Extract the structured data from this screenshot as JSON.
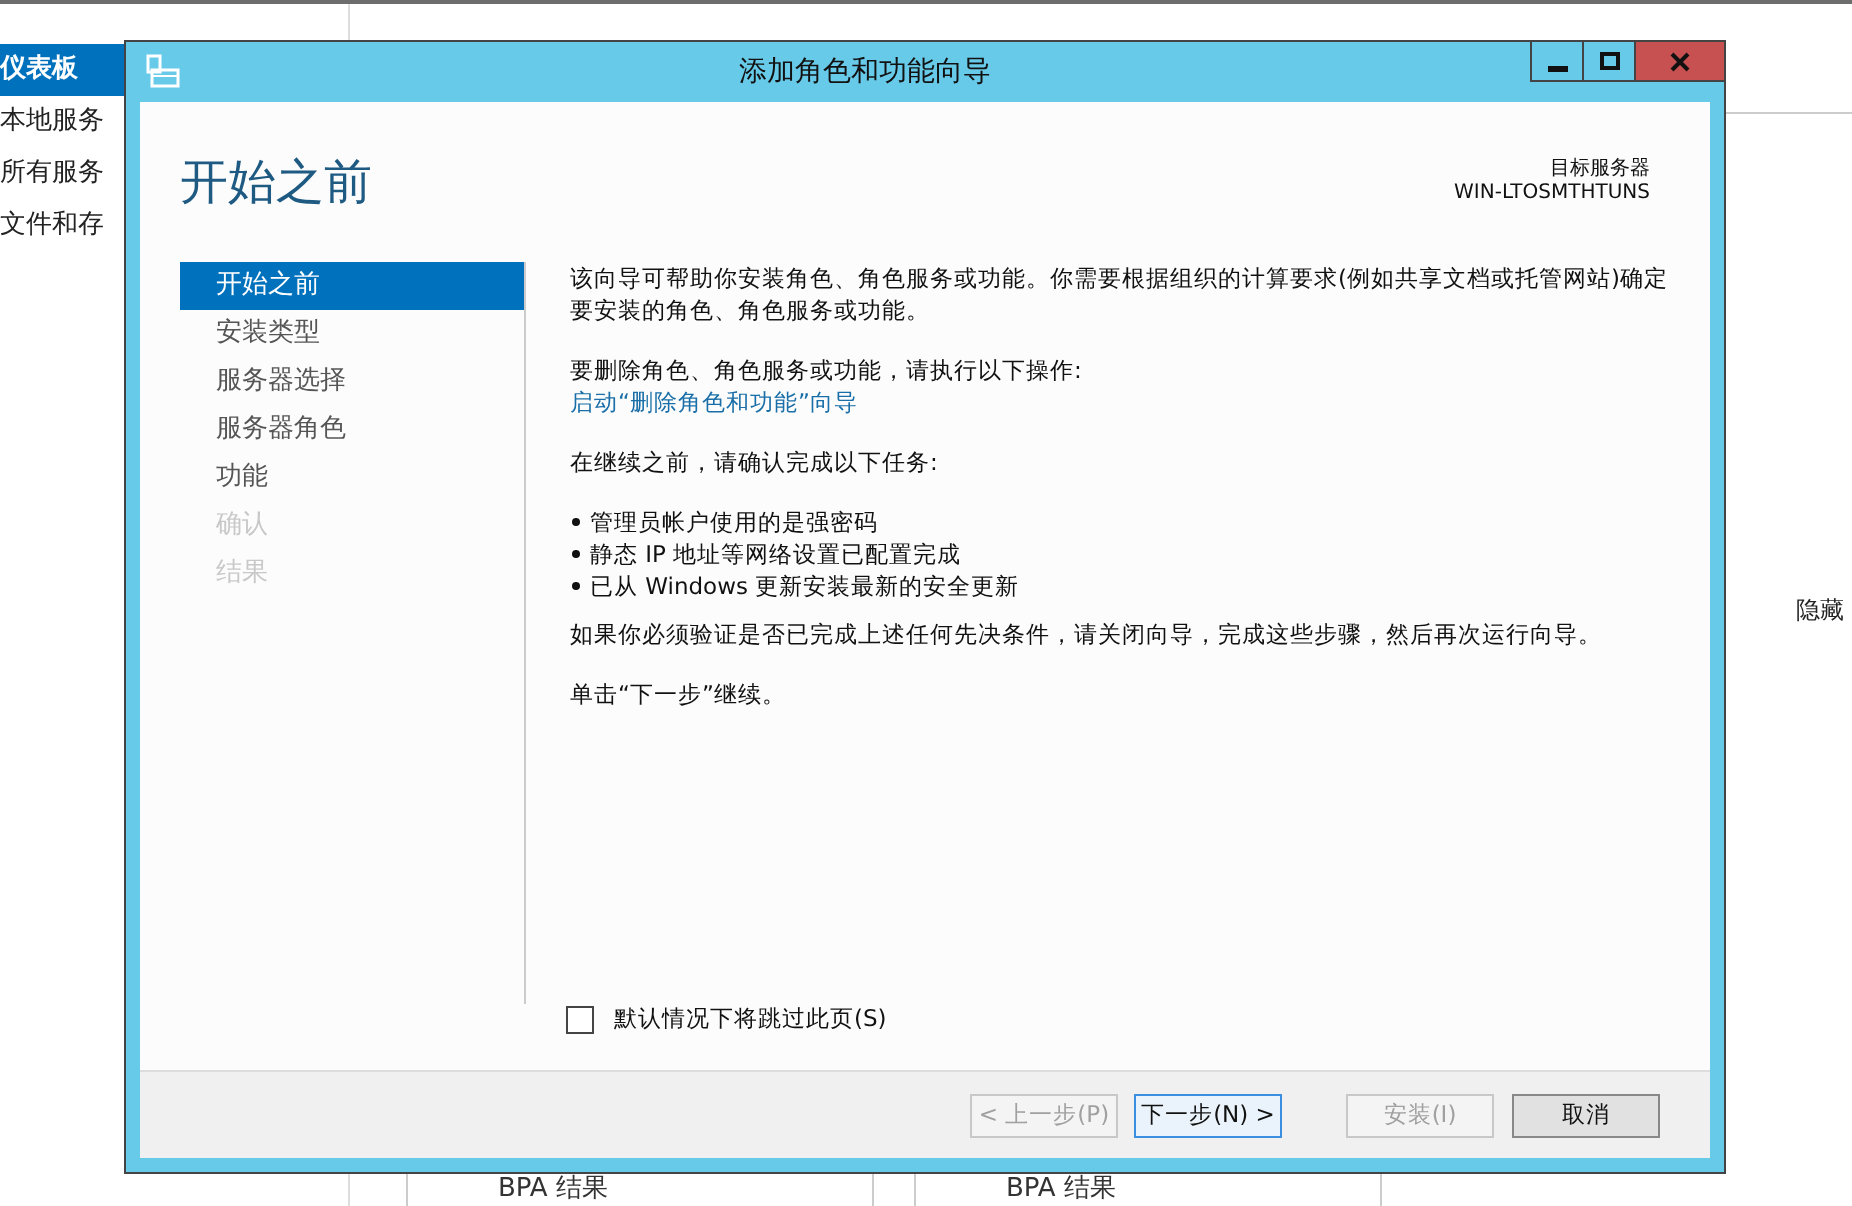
{
  "background": {
    "nav_items": [
      {
        "label": "仪表板",
        "selected": true
      },
      {
        "label": "本地服务",
        "selected": false
      },
      {
        "label": "所有服务",
        "selected": false
      },
      {
        "label": "文件和存",
        "selected": false
      }
    ],
    "hide_label": "隐藏",
    "tiles": [
      {
        "label": "BPA 结果"
      },
      {
        "label": "BPA 结果"
      }
    ]
  },
  "window": {
    "title": "添加角色和功能向导",
    "heading": "开始之前",
    "target_label": "目标服务器",
    "target_server": "WIN-LTOSMTHTUNS",
    "steps": [
      {
        "label": "开始之前",
        "selected": true,
        "disabled": false
      },
      {
        "label": "安装类型",
        "selected": false,
        "disabled": false
      },
      {
        "label": "服务器选择",
        "selected": false,
        "disabled": false
      },
      {
        "label": "服务器角色",
        "selected": false,
        "disabled": false
      },
      {
        "label": "功能",
        "selected": false,
        "disabled": false
      },
      {
        "label": "确认",
        "selected": false,
        "disabled": true
      },
      {
        "label": "结果",
        "selected": false,
        "disabled": true
      }
    ],
    "intro": "该向导可帮助你安装角色、角色服务或功能。你需要根据组织的计算要求(例如共享文档或托管网站)确定要安装的角色、角色服务或功能。",
    "remove_text": "要删除角色、角色服务或功能，请执行以下操作:",
    "remove_link": "启动“删除角色和功能”向导",
    "tasks_heading": "在继续之前，请确认完成以下任务:",
    "tasks": [
      "管理员帐户使用的是强密码",
      "静态 IP 地址等网络设置已配置完成",
      "已从 Windows 更新安装最新的安全更新"
    ],
    "verify_text": "如果你必须验证是否已完成上述任何先决条件，请关闭向导，完成这些步骤，然后再次运行向导。",
    "continue_text": "单击“下一步”继续。",
    "skip_checkbox": {
      "label": "默认情况下将跳过此页(S)",
      "checked": false
    },
    "buttons": [
      {
        "label": "< 上一步(P)",
        "disabled": true,
        "focused": false
      },
      {
        "label": "下一步(N) >",
        "disabled": false,
        "focused": true
      },
      {
        "label": "安装(I)",
        "disabled": true,
        "focused": false
      },
      {
        "label": "取消",
        "disabled": false,
        "focused": false
      }
    ]
  }
}
